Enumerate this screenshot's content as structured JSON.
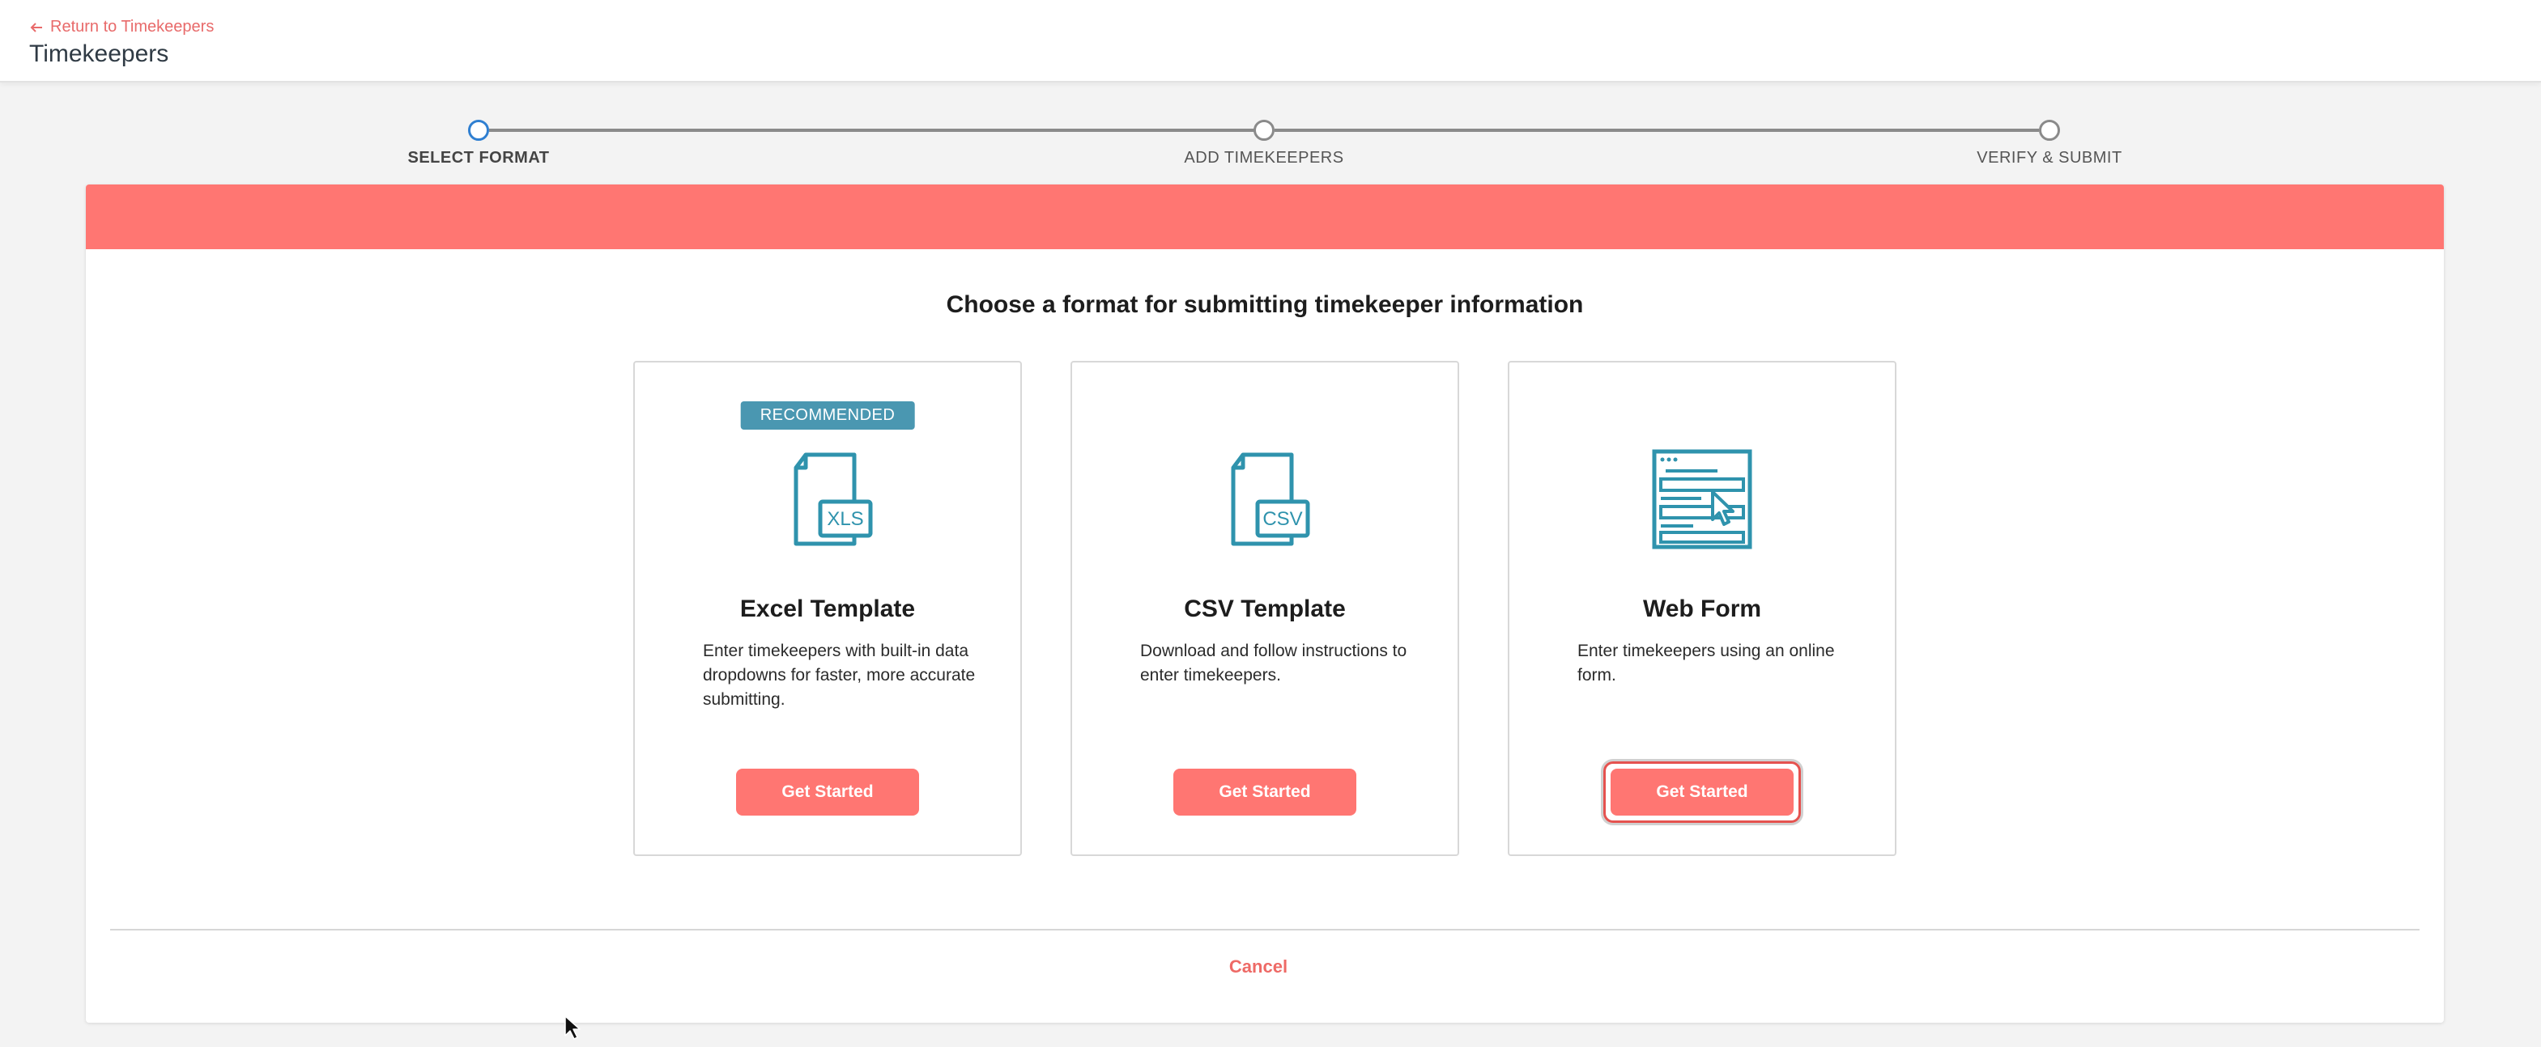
{
  "header": {
    "back_link": "Return to Timekeepers",
    "title": "Timekeepers"
  },
  "stepper": {
    "steps": [
      {
        "label": "SELECT FORMAT",
        "active": true
      },
      {
        "label": "ADD TIMEKEEPERS",
        "active": false
      },
      {
        "label": "VERIFY & SUBMIT",
        "active": false
      }
    ]
  },
  "colors": {
    "banner": "#ff7672",
    "accent": "#ff7672",
    "icon": "#2f93ad",
    "badge": "#4a97b1",
    "step_active": "#2f7fd1"
  },
  "main": {
    "heading": "Choose a format for submitting timekeeper information",
    "options": [
      {
        "badge": "RECOMMENDED",
        "icon": "xls-file-icon",
        "icon_text": "XLS",
        "title": "Excel Template",
        "description": "Enter timekeepers with built-in data dropdowns for faster, more accurate submitting.",
        "button": "Get Started"
      },
      {
        "icon": "csv-file-icon",
        "icon_text": "CSV",
        "title": "CSV Template",
        "description": "Download and follow instructions to enter timekeepers.",
        "button": "Get Started"
      },
      {
        "icon": "web-form-icon",
        "title": "Web Form",
        "description": "Enter timekeepers using an online form.",
        "button": "Get Started",
        "focused": true
      }
    ],
    "cancel": "Cancel"
  }
}
